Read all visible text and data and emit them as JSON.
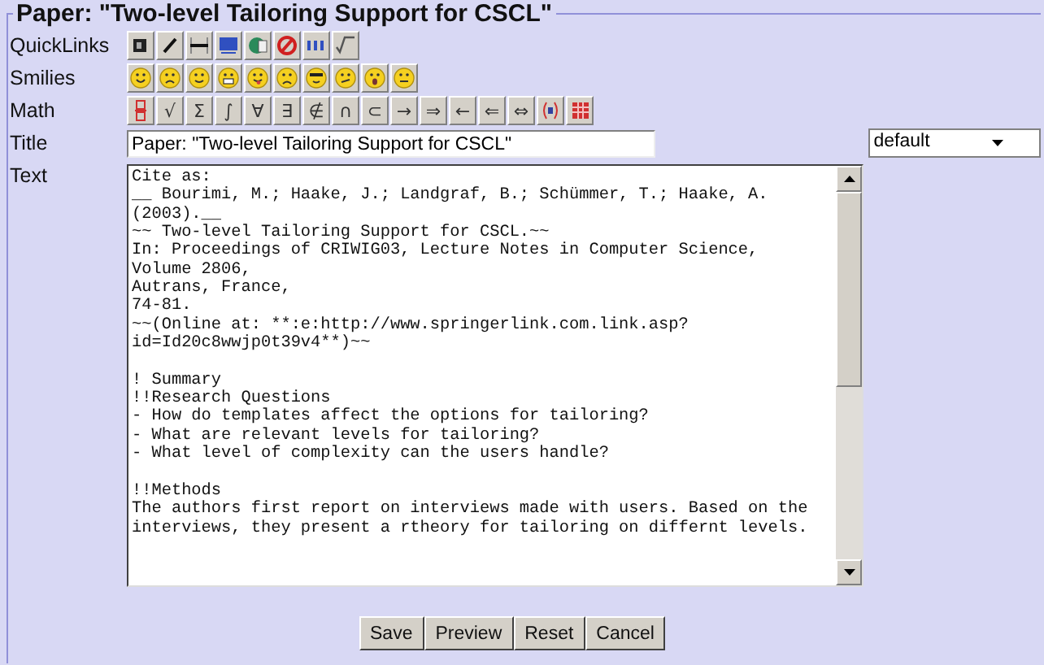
{
  "form": {
    "legend": "Paper: \"Two-level Tailoring Support for CSCL\"",
    "quicklinks": {
      "label": "QuickLinks",
      "buttons": [
        {
          "kind": "bold"
        },
        {
          "kind": "italic"
        },
        {
          "kind": "rule"
        },
        {
          "kind": "abbr"
        },
        {
          "kind": "globe"
        },
        {
          "kind": "forbidden"
        },
        {
          "kind": "list"
        },
        {
          "kind": "root"
        }
      ]
    },
    "smilies": {
      "label": "Smilies",
      "buttons": [
        {
          "kind": "smile"
        },
        {
          "kind": "sad"
        },
        {
          "kind": "wink"
        },
        {
          "kind": "grin"
        },
        {
          "kind": "tongue"
        },
        {
          "kind": "frown"
        },
        {
          "kind": "cool"
        },
        {
          "kind": "smirk"
        },
        {
          "kind": "surprised"
        },
        {
          "kind": "neutral"
        }
      ]
    },
    "math": {
      "label": "Math",
      "buttons": [
        {
          "kind": "fraction"
        },
        {
          "kind": "glyph",
          "symbol": "√"
        },
        {
          "kind": "glyph",
          "symbol": "Σ"
        },
        {
          "kind": "glyph",
          "symbol": "∫"
        },
        {
          "kind": "glyph",
          "symbol": "∀"
        },
        {
          "kind": "glyph",
          "symbol": "∃"
        },
        {
          "kind": "glyph",
          "symbol": "∉"
        },
        {
          "kind": "glyph",
          "symbol": "∩"
        },
        {
          "kind": "glyph",
          "symbol": "⊂"
        },
        {
          "kind": "glyph",
          "symbol": "→"
        },
        {
          "kind": "glyph",
          "symbol": "⇒"
        },
        {
          "kind": "glyph",
          "symbol": "←"
        },
        {
          "kind": "glyph",
          "symbol": "⇐"
        },
        {
          "kind": "glyph",
          "symbol": "⇔"
        },
        {
          "kind": "paren"
        },
        {
          "kind": "matrix"
        }
      ]
    },
    "title": {
      "label": "Title",
      "value": "Paper: \"Two-level Tailoring Support for CSCL\"",
      "select": "default"
    },
    "text": {
      "label": "Text",
      "value": "Cite as:\n__ Bourimi, M.; Haake, J.; Landgraf, B.; Schümmer, T.; Haake, A.\n(2003).__\n~~ Two-level Tailoring Support for CSCL.~~\nIn: Proceedings of CRIWIG03, Lecture Notes in Computer Science,\nVolume 2806,\nAutrans, France,\n74-81.\n~~(Online at: **:e:http://www.springerlink.com.link.asp?\nid=Id20c8wwjp0t39v4**)~~\n\n! Summary\n!!Research Questions\n- How do templates affect the options for tailoring?\n- What are relevant levels for tailoring?\n- What level of complexity can the users handle?\n\n!!Methods\nThe authors first report on interviews made with users. Based on the\ninterviews, they present a rtheory for tailoring on differnt levels."
    },
    "buttons": [
      "Save",
      "Preview",
      "Reset",
      "Cancel"
    ]
  }
}
